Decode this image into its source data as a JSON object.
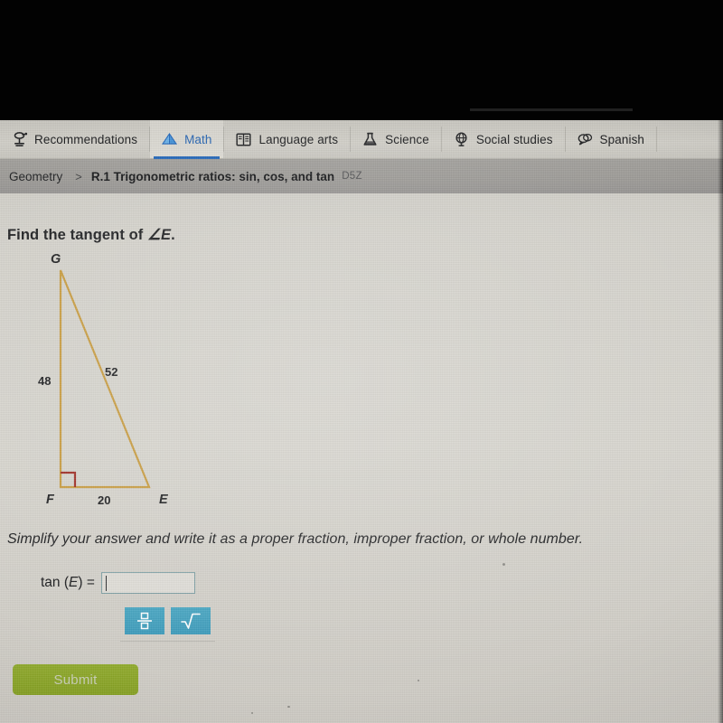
{
  "nav": {
    "tabs": [
      {
        "label": "Recommendations",
        "icon": "podium-icon",
        "active": false
      },
      {
        "label": "Math",
        "icon": "diamond-prism-icon",
        "active": true
      },
      {
        "label": "Language arts",
        "icon": "open-book-icon",
        "active": false
      },
      {
        "label": "Science",
        "icon": "flask-icon",
        "active": false
      },
      {
        "label": "Social studies",
        "icon": "globe-icon",
        "active": false
      },
      {
        "label": "Spanish",
        "icon": "speech-bubbles-icon",
        "active": false
      }
    ],
    "active_color": "#1f63b6"
  },
  "breadcrumb": {
    "subject": "Geometry",
    "separator": ">",
    "skill": "R.1 Trigonometric ratios: sin, cos, and tan",
    "code": "D5Z"
  },
  "question": {
    "prompt_prefix": "Find the tangent of ",
    "prompt_angle": "∠E",
    "prompt_suffix": ".",
    "instruction": "Simplify your answer and write it as a proper fraction, improper fraction, or whole number."
  },
  "figure": {
    "type": "right-triangle",
    "vertices": [
      {
        "name": "G",
        "position": "top"
      },
      {
        "name": "F",
        "position": "bottom-left"
      },
      {
        "name": "E",
        "position": "bottom-right"
      }
    ],
    "side_labels": [
      {
        "value": "48",
        "between": "G-F"
      },
      {
        "value": "52",
        "between": "G-E"
      },
      {
        "value": "20",
        "between": "F-E"
      }
    ],
    "right_angle_at": "F",
    "stroke_color": "#c79a3c",
    "right_angle_color": "#9e2a22"
  },
  "answer": {
    "label_prefix": "tan (",
    "label_var": "E",
    "label_suffix": ") =",
    "value": "",
    "placeholder": ""
  },
  "keypad": {
    "buttons": [
      {
        "name": "fraction-button",
        "glyph": "fraction"
      },
      {
        "name": "square-root-button",
        "glyph": "radical"
      }
    ],
    "color": "#3f9fbd"
  },
  "submit": {
    "label": "Submit",
    "color": "#8aa526"
  }
}
